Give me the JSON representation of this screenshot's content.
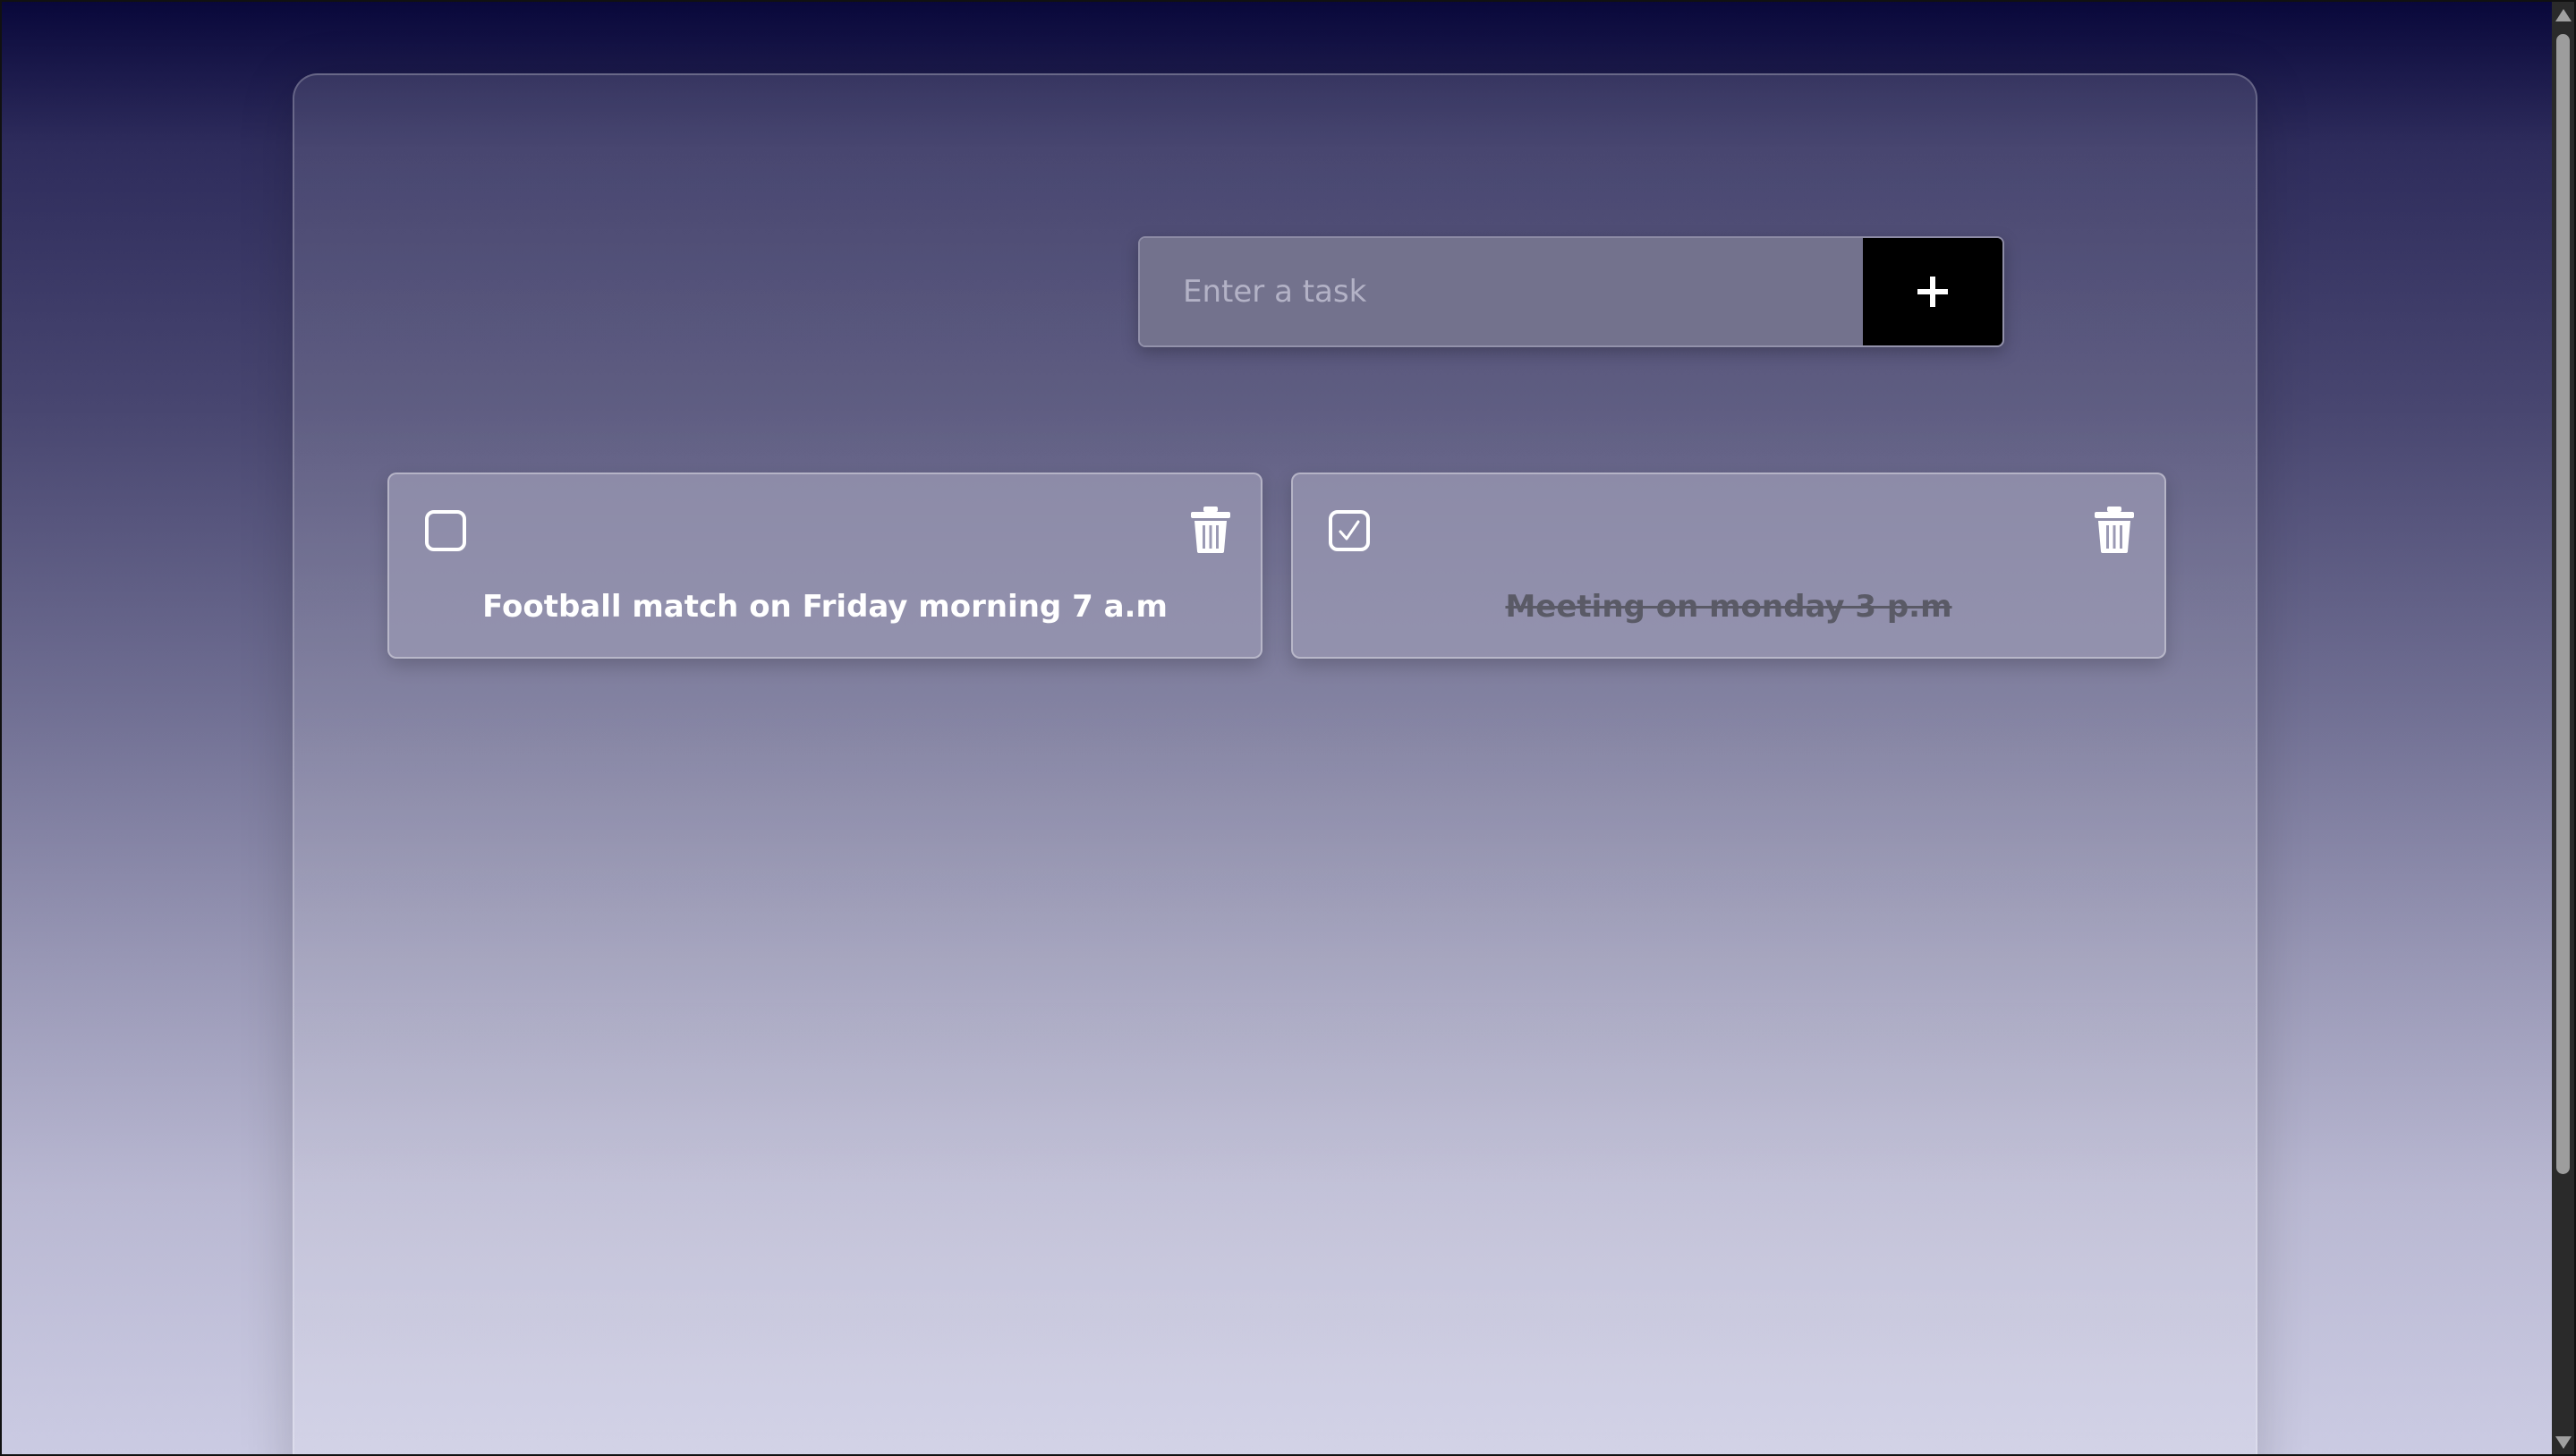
{
  "input": {
    "placeholder": "Enter a task",
    "value": ""
  },
  "add_button": {
    "icon": "plus-icon",
    "icon_glyph": "+"
  },
  "tasks": [
    {
      "text": "Football match on Friday morning 7 a.m",
      "completed": false
    },
    {
      "text": "Meeting on monday 3 p.m",
      "completed": true
    }
  ],
  "colors": {
    "background_top": "#08073a",
    "background_bottom": "#cbcbe3",
    "add_button": "#000000",
    "input_bg": "#73728d",
    "completed_text": "#5a5a66"
  }
}
